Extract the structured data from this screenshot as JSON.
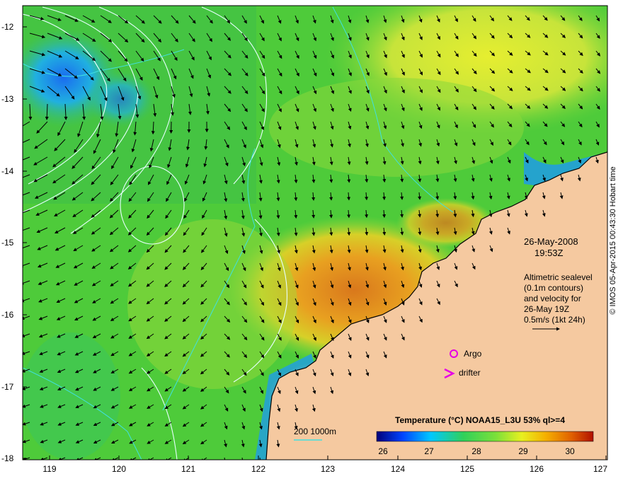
{
  "map": {
    "date": "26-May-2008",
    "time": "19:53Z",
    "altimetry_note": [
      "Altimetric sealevel",
      "(0.1m contours)",
      "and velocity for",
      "26-May 19Z"
    ],
    "velocity_scale_label": "0.5m/s (1kt 24h)",
    "argo_label": "Argo",
    "drifter_label": "drifter",
    "bathy_label": "200  1000m",
    "colorbar_title": "Temperature (°C) NOAA15_L3U 53% ql>=4",
    "colorbar_ticks": [
      "26",
      "27",
      "28",
      "29",
      "30"
    ],
    "credit": "© IMOS 05-Apr-2015 00:43:30 Hobart time",
    "lat_ticks": [
      "-12",
      "-13",
      "-14",
      "-15",
      "-16",
      "-17",
      "-18"
    ],
    "lon_ticks": [
      "119",
      "120",
      "121",
      "122",
      "123",
      "124",
      "125",
      "126",
      "127"
    ],
    "colors": {
      "land": "#f5c9a0",
      "ocean_base": "#4ecb3a",
      "argo": "#e600e6",
      "drifter": "#e600e6",
      "sst_cold": "#0a2090",
      "sst_warm": "#e07010",
      "contour": "#e8ffff",
      "bathy": "#40e0e0"
    },
    "colorbar_colors": [
      "#00007a",
      "#0044ff",
      "#00c8ff",
      "#30d05a",
      "#7be03a",
      "#e8f020",
      "#f5b000",
      "#e06000",
      "#b01000"
    ]
  }
}
